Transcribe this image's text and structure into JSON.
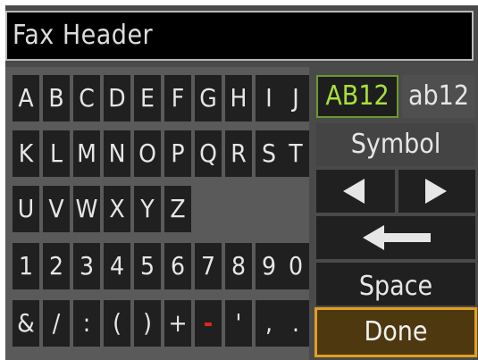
{
  "header": {
    "title": "Fax Header"
  },
  "keyboard": {
    "rows": [
      [
        "A",
        "B",
        "C",
        "D",
        "E",
        "F",
        "G",
        "H",
        "I",
        "J"
      ],
      [
        "K",
        "L",
        "M",
        "N",
        "O",
        "P",
        "Q",
        "R",
        "S",
        "T"
      ],
      [
        "U",
        "V",
        "W",
        "X",
        "Y",
        "Z"
      ],
      [
        "1",
        "2",
        "3",
        "4",
        "5",
        "6",
        "7",
        "8",
        "9",
        "0"
      ],
      [
        "&",
        "/",
        ":",
        "(",
        ")",
        "+",
        "-",
        "'",
        ",",
        "."
      ]
    ]
  },
  "side": {
    "mode_upper": "AB12",
    "mode_lower": "ab12",
    "symbol": "Symbol",
    "space": "Space",
    "done": "Done"
  },
  "icons": {
    "cursor_left": "left-triangle-icon",
    "cursor_right": "right-triangle-icon",
    "backspace": "backspace-arrow-icon"
  },
  "colors": {
    "active_mode": "#a8e03c",
    "done_border": "#e0a020",
    "minus_key": "#e0281e"
  }
}
